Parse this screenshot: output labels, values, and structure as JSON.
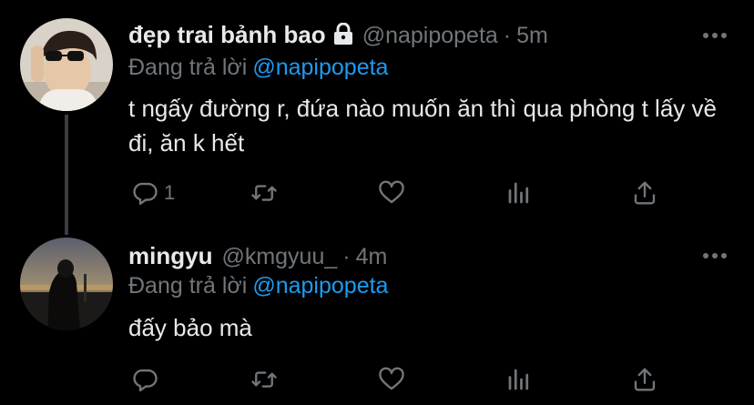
{
  "colors": {
    "background": "#000000",
    "text": "#e7e9ea",
    "muted": "#71767b",
    "link": "#1d9bf0",
    "thread_line": "#3a3d41"
  },
  "tweets": [
    {
      "display_name": "đẹp trai bảnh bao",
      "handle": "@napipopeta",
      "separator": "·",
      "time": "5m",
      "reply_prefix": "Đang trả lời",
      "reply_to": "@napipopeta",
      "text": "t ngấy đường r, đứa nào muốn ăn thì qua phòng t lấy về đi, ăn k hết",
      "reply_count": "1",
      "icons": [
        "lock-icon",
        "reply-icon",
        "retweet-icon",
        "like-icon",
        "analytics-icon",
        "share-icon",
        "more-icon"
      ]
    },
    {
      "display_name": "mingyu",
      "handle": "@kmgyuu_",
      "separator": "·",
      "time": "4m",
      "reply_prefix": "Đang trả lời",
      "reply_to": "@napipopeta",
      "text": "đấy bảo mà",
      "reply_count": "",
      "icons": [
        "reply-icon",
        "retweet-icon",
        "like-icon",
        "analytics-icon",
        "share-icon",
        "more-icon"
      ]
    }
  ]
}
